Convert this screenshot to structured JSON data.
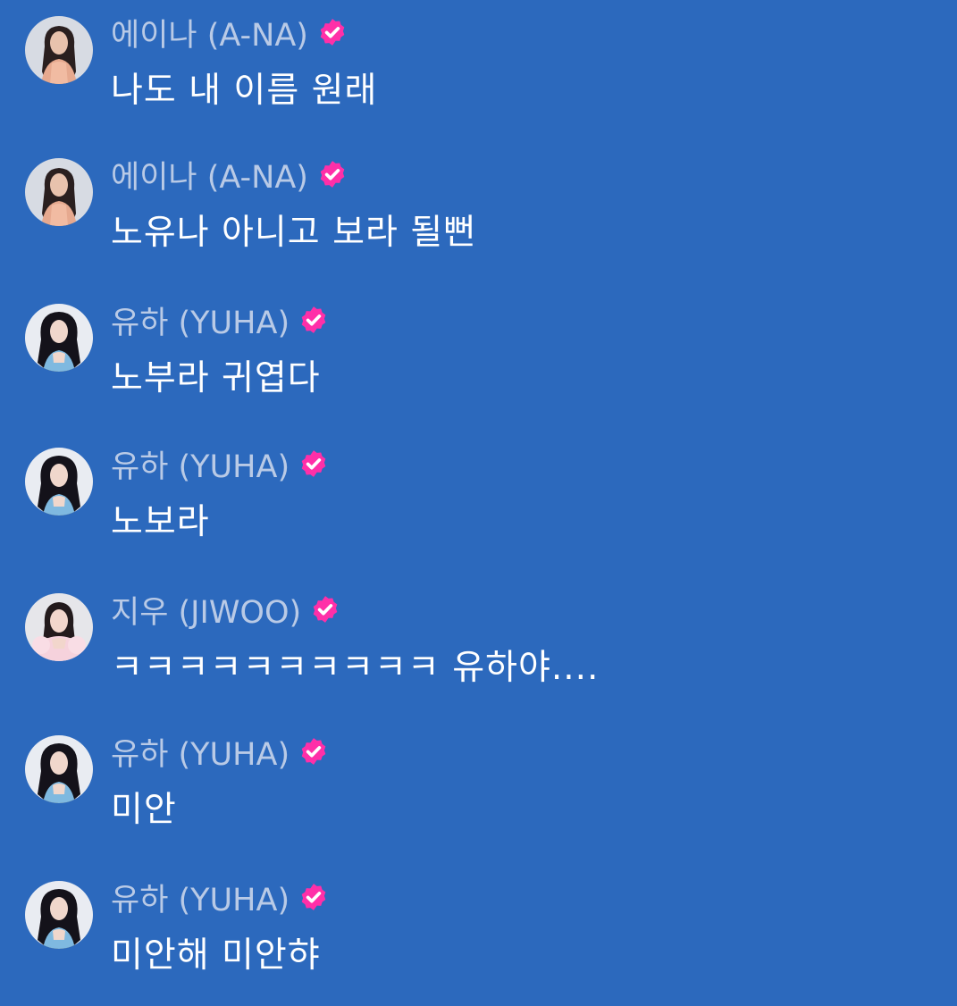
{
  "colors": {
    "background": "#2c69bd",
    "username": "#b9cae6",
    "message": "#ffffff",
    "verified_badge": "#ff2fa8"
  },
  "messages": [
    {
      "user": "에이나 (A-NA)",
      "text": "나도 내 이름 원래",
      "avatar": "ana-avatar",
      "verified": true
    },
    {
      "user": "에이나 (A-NA)",
      "text": "노유나 아니고 보라 될뻔",
      "avatar": "ana-avatar",
      "verified": true
    },
    {
      "user": "유하 (YUHA)",
      "text": "노부라 귀엽다",
      "avatar": "yuha-avatar",
      "verified": true
    },
    {
      "user": "유하 (YUHA)",
      "text": "노보라",
      "avatar": "yuha-avatar",
      "verified": true
    },
    {
      "user": "지우 (JIWOO)",
      "text": "ㅋㅋㅋㅋㅋㅋㅋㅋㅋㅋ 유하야....",
      "avatar": "jiwoo-avatar",
      "verified": true
    },
    {
      "user": "유하 (YUHA)",
      "text": "미안",
      "avatar": "yuha-avatar",
      "verified": true
    },
    {
      "user": "유하 (YUHA)",
      "text": "미안해 미안햐",
      "avatar": "yuha-avatar",
      "verified": true
    }
  ]
}
